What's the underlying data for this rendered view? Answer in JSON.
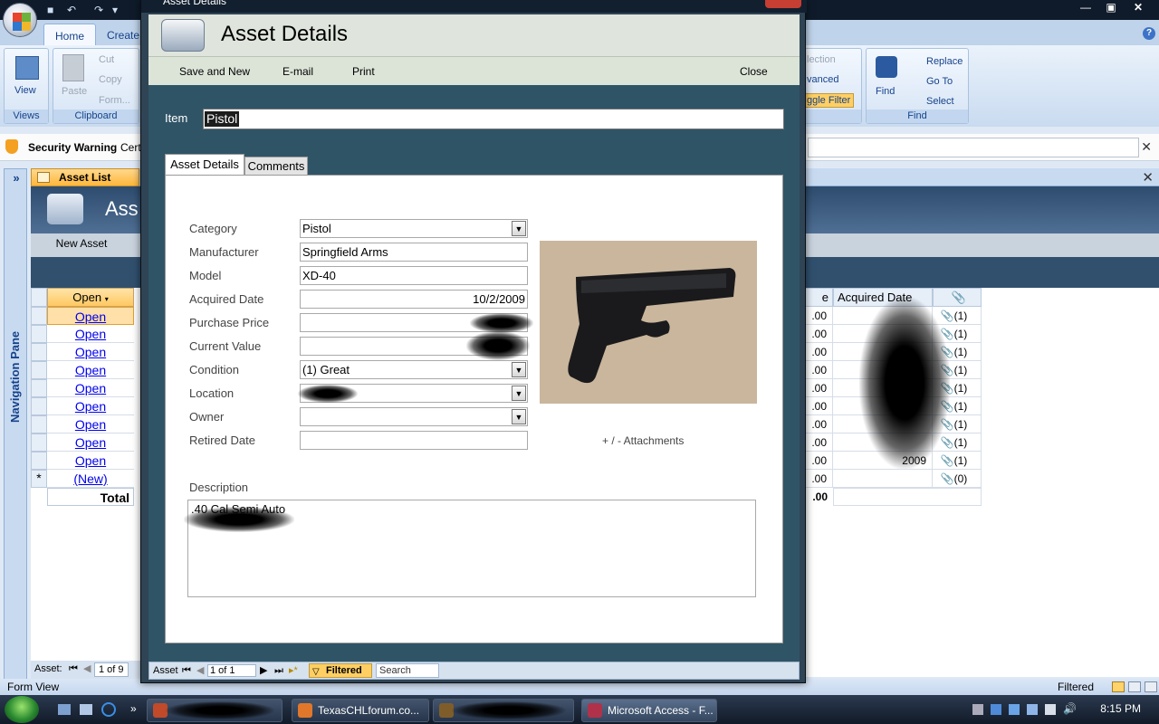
{
  "window": {
    "title": "Asset Details",
    "app_title": "Microsoft Access - F..."
  },
  "ribbon": {
    "tabs": [
      "Home",
      "Create"
    ],
    "clipboard": {
      "view": "View",
      "paste": "Paste",
      "cut": "Cut",
      "copy": "Copy",
      "format": "Form...",
      "group_views": "Views",
      "group_clipboard": "Clipboard"
    },
    "filter_partial": [
      "lection",
      "vanced",
      "ggle Filter"
    ],
    "find": {
      "find": "Find",
      "replace": "Replace",
      "goto": "Go To",
      "select": "Select",
      "group": "Find"
    }
  },
  "security": {
    "label": "Security Warning",
    "text": "Cert"
  },
  "nav_pane": {
    "label": "Navigation Pane"
  },
  "doc_tab": {
    "label": "Asset List"
  },
  "asset_list": {
    "title": "Ass",
    "new_asset": "New Asset",
    "columns": {
      "open": "Open",
      "partial": "e",
      "acquired": "Acquired Date",
      "attach_icon": "paperclip-icon"
    },
    "rows": [
      {
        "open": "Open",
        "val": ".00",
        "attach": "(1)"
      },
      {
        "open": "Open",
        "val": ".00",
        "attach": "(1)"
      },
      {
        "open": "Open",
        "val": ".00",
        "attach": "(1)"
      },
      {
        "open": "Open",
        "val": ".00",
        "attach": "(1)"
      },
      {
        "open": "Open",
        "val": ".00",
        "attach": "(1)"
      },
      {
        "open": "Open",
        "val": ".00",
        "attach": "(1)"
      },
      {
        "open": "Open",
        "val": ".00",
        "attach": "(1)"
      },
      {
        "open": "Open",
        "val": ".00",
        "attach": "(1)"
      },
      {
        "open": "Open",
        "val": ".00",
        "attach": "(1)",
        "acquired_partial": "1",
        "acq_tail": "2009"
      },
      {
        "open": "(New)",
        "val": ".00",
        "attach": "(0)"
      }
    ],
    "total_label": "Total",
    "total_val": ".00",
    "record_nav": {
      "label": "Asset:",
      "position": "1 of 9"
    }
  },
  "dialog": {
    "header_title": "Asset Details",
    "toolbar": {
      "save_new": "Save and New",
      "email": "E-mail",
      "print": "Print",
      "close": "Close"
    },
    "item": {
      "label": "Item",
      "value": "Pistol"
    },
    "tabs": [
      "Asset Details",
      "Comments"
    ],
    "fields": {
      "category": {
        "label": "Category",
        "value": "Pistol"
      },
      "manufacturer": {
        "label": "Manufacturer",
        "value": "Springfield Arms"
      },
      "model": {
        "label": "Model",
        "value": "XD-40"
      },
      "acquired": {
        "label": "Acquired Date",
        "value": "10/2/2009"
      },
      "purchase_price": {
        "label": "Purchase Price",
        "value": ""
      },
      "current_value": {
        "label": "Current Value",
        "value": ""
      },
      "condition": {
        "label": "Condition",
        "value": "(1) Great"
      },
      "location": {
        "label": "Location",
        "value": ""
      },
      "owner": {
        "label": "Owner",
        "value": ""
      },
      "retired": {
        "label": "Retired Date",
        "value": ""
      }
    },
    "attachments": {
      "label": "+ / -  Attachments"
    },
    "description": {
      "label": "Description",
      "value": ".40 Cal Semi Auto"
    },
    "record_nav": {
      "label": "Asset",
      "position": "1 of 1",
      "filtered": "Filtered",
      "search": "Search"
    }
  },
  "status_bar": {
    "left": "Form View",
    "right": "Filtered"
  },
  "taskbar": {
    "items": [
      {
        "label": "",
        "icon": "app-icon"
      },
      {
        "label": "TexasCHLforum.co...",
        "icon": "firefox-icon"
      },
      {
        "label": "",
        "icon": "app-icon"
      },
      {
        "label": "Microsoft Access - F...",
        "icon": "access-icon"
      }
    ],
    "clock": "8:15 PM"
  },
  "colors": {
    "dialog_body": "#2f5466",
    "ribbon_tab_text": "#15428b",
    "grid_header": "#ffc861"
  }
}
